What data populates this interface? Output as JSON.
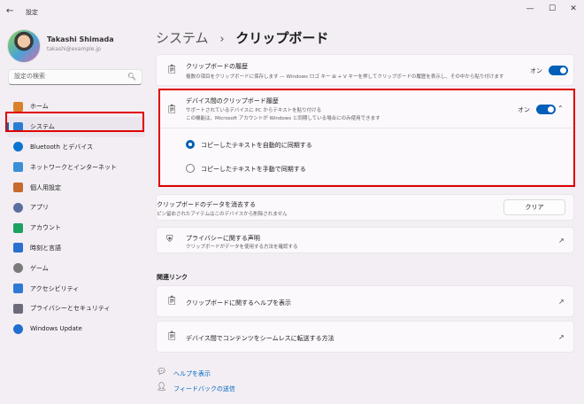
{
  "window": {
    "title": "設定",
    "back": "←",
    "minimize": "—",
    "maximize": "☐",
    "close": "✕"
  },
  "user": {
    "name": "Takashi Shimada",
    "email": "takashi@example.jp"
  },
  "search": {
    "placeholder": "設定の検索"
  },
  "nav": [
    {
      "label": "ホーム",
      "icon": "home-icon",
      "color": "#d9822b"
    },
    {
      "label": "システム",
      "icon": "system-icon",
      "color": "#2b7cd3",
      "active": true
    },
    {
      "label": "Bluetooth とデバイス",
      "icon": "bluetooth-icon",
      "color": "#0a74d0"
    },
    {
      "label": "ネットワークとインターネット",
      "icon": "network-icon",
      "color": "#3a8fd6"
    },
    {
      "label": "個人用設定",
      "icon": "personalization-icon",
      "color": "#c76a2e"
    },
    {
      "label": "アプリ",
      "icon": "apps-icon",
      "color": "#5a6ea0"
    },
    {
      "label": "アカウント",
      "icon": "account-icon",
      "color": "#1aa260"
    },
    {
      "label": "時刻と言語",
      "icon": "time-language-icon",
      "color": "#2b6fd0"
    },
    {
      "label": "ゲーム",
      "icon": "gaming-icon",
      "color": "#7a7a7a"
    },
    {
      "label": "アクセシビリティ",
      "icon": "accessibility-icon",
      "color": "#2d7ad6"
    },
    {
      "label": "プライバシーとセキュリティ",
      "icon": "privacy-icon",
      "color": "#6b6b7b"
    },
    {
      "label": "Windows Update",
      "icon": "windows-update-icon",
      "color": "#1f6fcf"
    }
  ],
  "breadcrumb": {
    "parent": "システム",
    "separator": "›",
    "current": "クリップボード"
  },
  "history": {
    "title": "クリップボードの履歴",
    "desc": "複数の項目をクリップボードに保存します — Windows ロゴ キー ⊞ + V キーを押してクリップボードの履歴を表示し、その中から貼り付けます",
    "toggle_label": "オン"
  },
  "sync": {
    "title": "デバイス間のクリップボード履歴",
    "desc1": "サポートされているデバイスに PC からテキストを貼り付ける",
    "desc2": "この機能は、Microsoft アカウントが Windows と同期している場合にのみ使用できます",
    "toggle_label": "オン",
    "options": [
      "コピーしたテキストを自動的に同期する",
      "コピーしたテキストを手動で同期する"
    ]
  },
  "clear": {
    "title": "クリップボードのデータを消去する",
    "desc": "ピン留めされたアイテムはこのデバイスから削除されません",
    "button": "クリア"
  },
  "privacy": {
    "title": "プライバシーに関する声明",
    "desc": "クリップボードがデータを使用する方法を確認する"
  },
  "related": {
    "heading": "関連リンク",
    "links": [
      "クリップボードに関するヘルプを表示",
      "デバイス間でコンテンツをシームレスに転送する方法"
    ]
  },
  "footer": {
    "help": "ヘルプを表示",
    "feedback": "フィードバックの送信"
  }
}
